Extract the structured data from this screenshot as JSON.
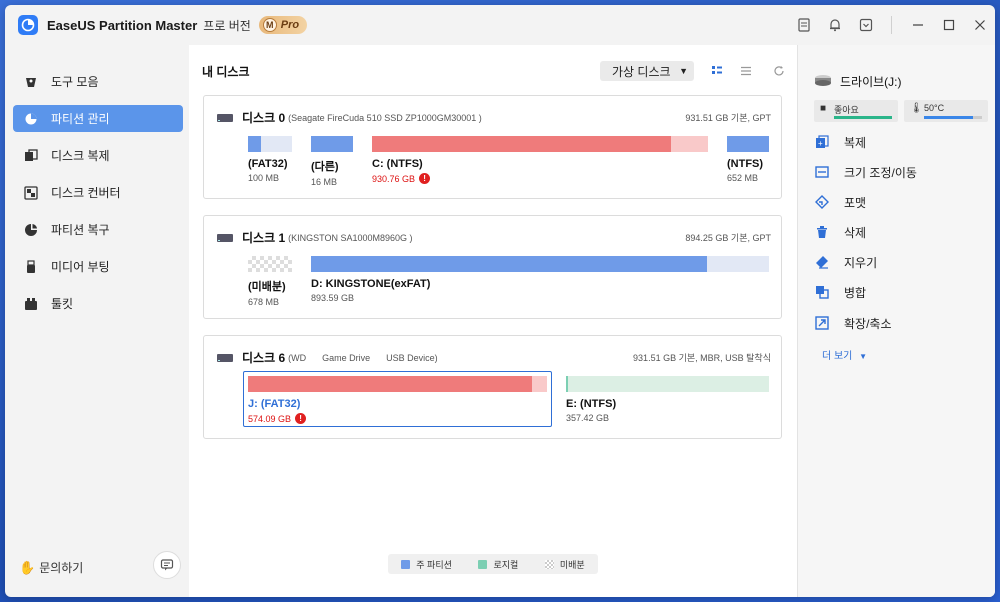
{
  "app": {
    "title": "EaseUS Partition Master",
    "edition": "프로 버전",
    "badge_letter": "M",
    "badge_text": "Pro"
  },
  "sidebar": {
    "items": [
      {
        "label": "도구 모음",
        "icon": "toolbox-icon"
      },
      {
        "label": "파티션 관리",
        "icon": "pie-chart-icon"
      },
      {
        "label": "디스크 복제",
        "icon": "clone-icon"
      },
      {
        "label": "디스크 컨버터",
        "icon": "convert-icon"
      },
      {
        "label": "파티션 복구",
        "icon": "recover-icon"
      },
      {
        "label": "미디어 부팅",
        "icon": "usb-icon"
      },
      {
        "label": "툴킷",
        "icon": "toolkit-icon"
      }
    ],
    "active_index": 1,
    "help_label": "문의하기"
  },
  "main": {
    "title": "내 디스크",
    "virtual_disk_label": "가상 디스크"
  },
  "disks": [
    {
      "name": "디스크 0",
      "model": "(Seagate FireCuda 510 SSD ZP1000GM30001 )",
      "info": "931.51 GB 기본, GPT",
      "partitions": [
        {
          "label": "(FAT32)",
          "size": "100 MB",
          "used_fraction": 0.3
        },
        {
          "label": "(다른)",
          "size": "16 MB",
          "used_fraction": 1.0
        },
        {
          "label": "C: (NTFS)",
          "size": "930.76 GB",
          "used_fraction": 0.91,
          "warning": true
        },
        {
          "label": "(NTFS)",
          "size": "652 MB",
          "used_fraction": 1.0
        }
      ]
    },
    {
      "name": "디스크 1",
      "model": "(KINGSTON SA1000M8960G )",
      "info": "894.25 GB 기본, GPT",
      "partitions": [
        {
          "label": "(미배분)",
          "size": "678 MB",
          "unallocated": true
        },
        {
          "label": "D: KINGSTONE(exFAT)",
          "size": "893.59 GB",
          "used_fraction": 0.87
        }
      ]
    },
    {
      "name": "디스크 6",
      "model_parts": [
        "(WD",
        "Game Drive",
        "USB Device)"
      ],
      "info": "931.51 GB 기본, MBR, USB 탈착식",
      "partitions": [
        {
          "label": "J: (FAT32)",
          "size": "574.09 GB",
          "used_fraction": 0.95,
          "warning": true,
          "selected": true
        },
        {
          "label": "E: (NTFS)",
          "size": "357.42 GB",
          "used_fraction": 0.01
        }
      ]
    }
  ],
  "legend": {
    "primary": "주 파티션",
    "logical": "로지컬",
    "unallocated": "미배분"
  },
  "right_panel": {
    "drive_title": "드라이브(J:)",
    "health_label": "좋아요",
    "temp_label": "50°C",
    "actions": [
      {
        "label": "복제",
        "icon": "clone-icon"
      },
      {
        "label": "크기 조정/이동",
        "icon": "resize-icon"
      },
      {
        "label": "포맷",
        "icon": "format-icon"
      },
      {
        "label": "삭제",
        "icon": "trash-icon"
      },
      {
        "label": "지우기",
        "icon": "eraser-icon"
      },
      {
        "label": "병합",
        "icon": "merge-icon"
      },
      {
        "label": "확장/축소",
        "icon": "expand-icon"
      }
    ],
    "more_label": "더 보기"
  },
  "colors": {
    "accent": "#5b95ea",
    "primary_partition": "#6f9be8",
    "primary_partition_light": "#e2e8f5",
    "warning_partition": "#ef7b7b",
    "warning_partition_light": "#f9c9c9",
    "logical_partition": "#7ccfb3",
    "logical_partition_light": "#dcefe4",
    "health_green": "#2bb58a",
    "temp_blue": "#3a86e8"
  }
}
